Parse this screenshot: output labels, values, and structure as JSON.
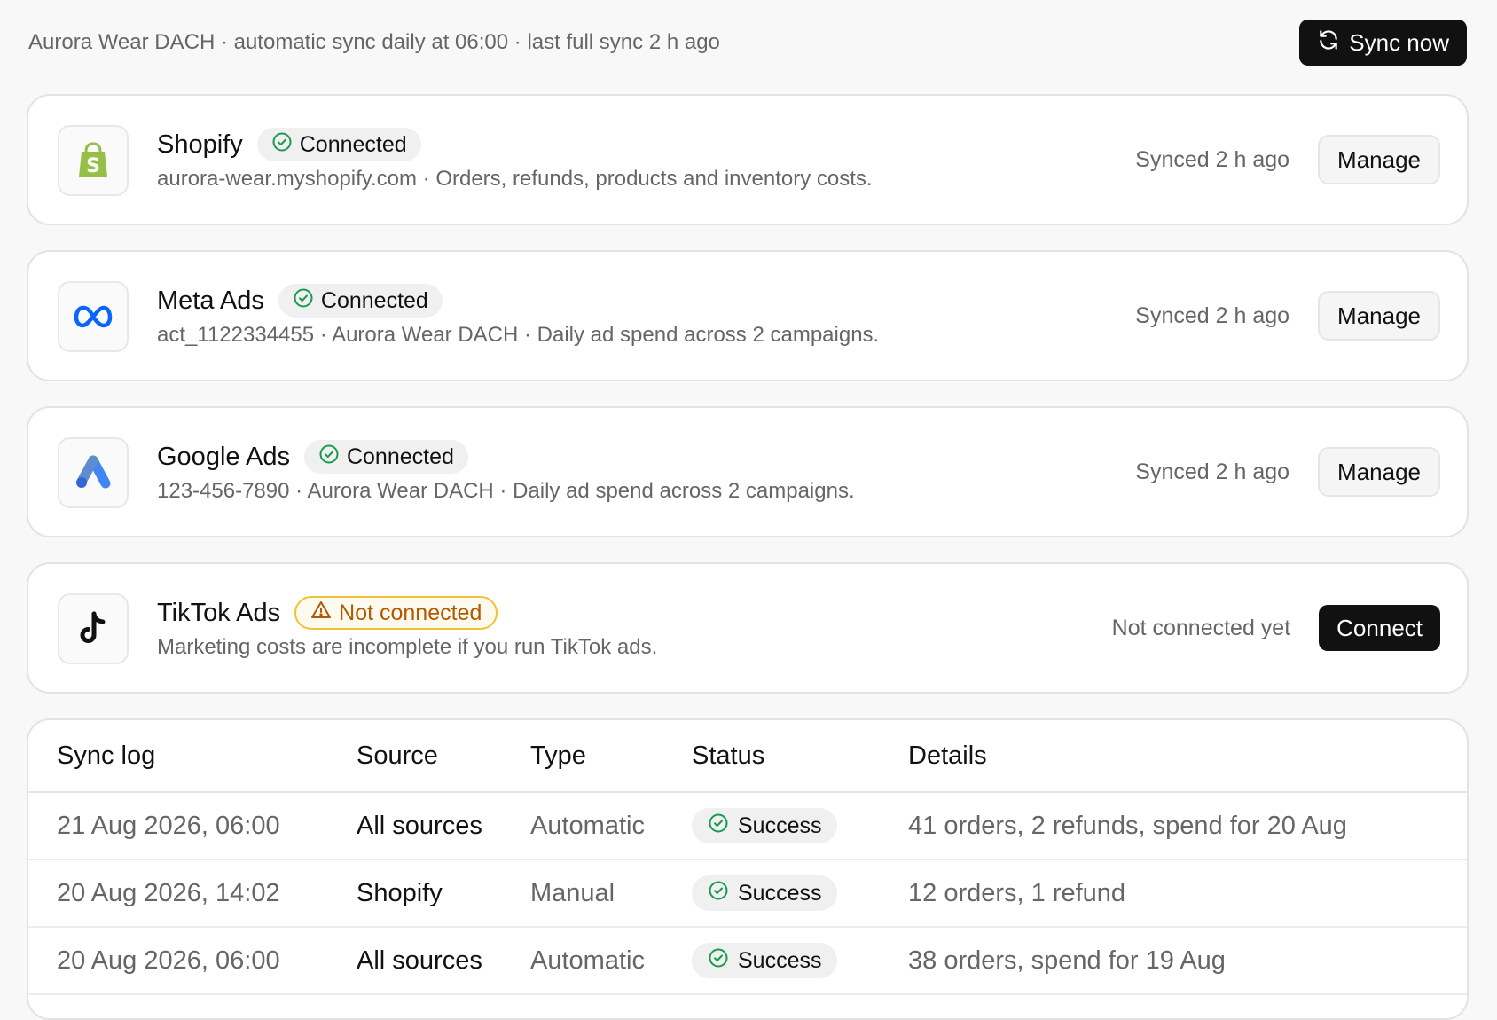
{
  "header": {
    "info": "Aurora Wear DACH · automatic sync daily at 06:00 · last full sync 2 h ago",
    "sync_button": "Sync now"
  },
  "integrations": [
    {
      "name": "Shopify",
      "status": "Connected",
      "description": "aurora-wear.myshopify.com · Orders, refunds, products and inventory costs.",
      "sync_text": "Synced 2 h ago",
      "action": "Manage",
      "icon": "shopify-logo"
    },
    {
      "name": "Meta Ads",
      "status": "Connected",
      "description": "act_1122334455 · Aurora Wear DACH · Daily ad spend across 2 campaigns.",
      "sync_text": "Synced 2 h ago",
      "action": "Manage",
      "icon": "meta-logo"
    },
    {
      "name": "Google Ads",
      "status": "Connected",
      "description": "123-456-7890 · Aurora Wear DACH · Daily ad spend across 2 campaigns.",
      "sync_text": "Synced 2 h ago",
      "action": "Manage",
      "icon": "google-ads-logo"
    },
    {
      "name": "TikTok Ads",
      "status": "Not connected",
      "description": "Marketing costs are incomplete if you run TikTok ads.",
      "sync_text": "Not connected yet",
      "action": "Connect",
      "icon": "tiktok-logo"
    }
  ],
  "sync_log": {
    "headers": [
      "Sync log",
      "Source",
      "Type",
      "Status",
      "Details"
    ],
    "rows": [
      {
        "date": "21 Aug 2026, 06:00",
        "source": "All sources",
        "type": "Automatic",
        "status": "Success",
        "details": "41 orders, 2 refunds, spend for 20 Aug"
      },
      {
        "date": "20 Aug 2026, 14:02",
        "source": "Shopify",
        "type": "Manual",
        "status": "Success",
        "details": "12 orders, 1 refund"
      },
      {
        "date": "20 Aug 2026, 06:00",
        "source": "All sources",
        "type": "Automatic",
        "status": "Success",
        "details": "38 orders, spend for 19 Aug"
      }
    ]
  },
  "colors": {
    "success_green": "#1a9a50",
    "warning_amber": "#b35a00",
    "shopify_green": "#95bf47",
    "meta_blue": "#0866ff",
    "google_blue": "#4285f4",
    "google_yellow": "#fbbc04"
  }
}
